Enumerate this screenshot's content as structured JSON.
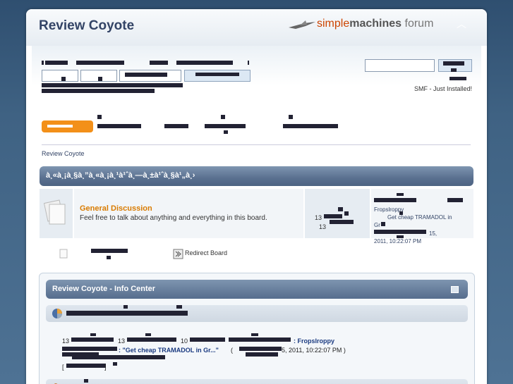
{
  "header": {
    "site_title": "Review Coyote",
    "logo": {
      "simple": "simple",
      "machines": "machines",
      "forum": " forum"
    },
    "collapse_icon": "chevron-up-icon"
  },
  "user": {
    "news": "SMF - Just Installed!"
  },
  "breadcrumb": "Review Coyote",
  "category": {
    "title": "à¸«à¸¡à¸§à¸”à¸«à¸¡à¸¹à¹ˆà¸—à¸±à¹ˆà¸§à¹„à¸›"
  },
  "board": {
    "name": "General Discussion",
    "description": "Feel free to talk about anything and everything in this board.",
    "posts_count": "13",
    "topics_count": "13",
    "last_post_user": "Fropslroppy",
    "last_post_subject": "Get cheap TRAMADOL in Gr...",
    "last_post_time_suffix": "15,",
    "last_post_time": "2011, 10:22:07 PM"
  },
  "legend": {
    "redirect": "Redirect Board"
  },
  "info_center": {
    "title": "Review Coyote - Info Center",
    "stats": {
      "posts": "13",
      "topics": "13",
      "members": "10",
      "latest_member": "Fropslroppy",
      "latest_post_subject": "\"Get cheap TRAMADOL in Gr...\"",
      "latest_post_open": " ( ",
      "latest_post_time": "5, 2011, 10:22:07 PM )",
      "bracket_open": "[",
      "bracket_close": "]"
    }
  },
  "colors": {
    "accent": "#f39019",
    "title": "#334466",
    "board_link": "#d97b00",
    "category_bar": "#5a7090"
  }
}
